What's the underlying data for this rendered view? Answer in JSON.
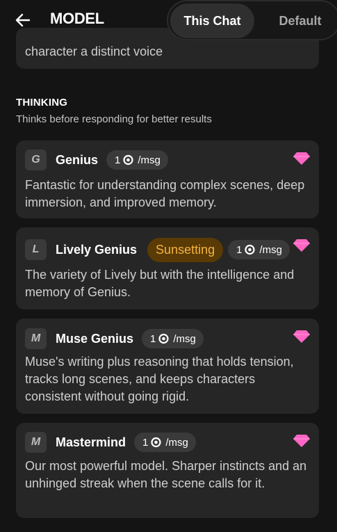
{
  "header": {
    "title": "MODEL",
    "back_icon": "back-arrow-icon",
    "tabs": [
      {
        "label": "This Chat",
        "active": true
      },
      {
        "label": "Default",
        "active": false
      }
    ]
  },
  "previous_card": {
    "description_fragment": "character a distinct voice"
  },
  "section": {
    "title": "THINKING",
    "subtitle": "Thinks before responding for better results"
  },
  "colors": {
    "background": "#141414",
    "card": "#262626",
    "pill": "#3a3a3a",
    "gem": "#ff66c4",
    "sunset_text": "#f5b340",
    "sunset_bg": "#5a3a05"
  },
  "models": [
    {
      "letter": "G",
      "name": "Genius",
      "price_amount": "1",
      "price_unit": "/msg",
      "description": "Fantastic for understanding complex scenes, deep immersion, and improved memory.",
      "premium_icon": "gem-icon"
    },
    {
      "letter": "L",
      "name": "Lively Genius",
      "badge": "Sunsetting",
      "price_amount": "1",
      "price_unit": "/msg",
      "description": "The variety of Lively but with the intelligence and memory of Genius.",
      "premium_icon": "gem-icon"
    },
    {
      "letter": "M",
      "name": "Muse Genius",
      "price_amount": "1",
      "price_unit": "/msg",
      "description": "Muse's writing plus reasoning that holds tension, tracks long scenes, and keeps characters consistent without going rigid.",
      "premium_icon": "gem-icon"
    },
    {
      "letter": "M",
      "name": "Mastermind",
      "price_amount": "1",
      "price_unit": "/msg",
      "description": "Our most powerful model. Sharper instincts and an unhinged streak when the scene calls for it.",
      "premium_icon": "gem-icon"
    }
  ]
}
